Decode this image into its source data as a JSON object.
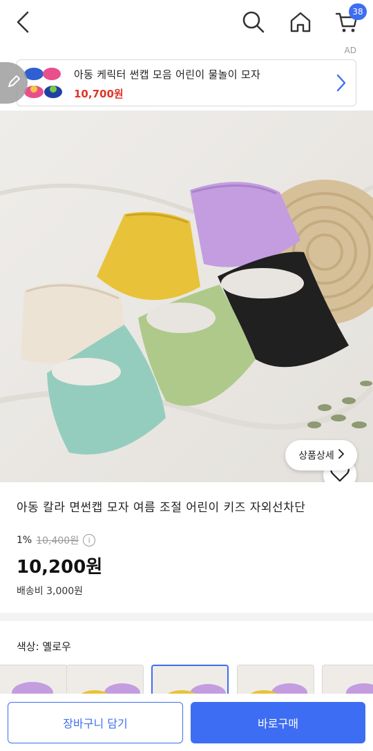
{
  "header": {
    "cart_count": "38",
    "icons": [
      "back-icon",
      "search-icon",
      "home-icon",
      "cart-icon"
    ]
  },
  "ad": {
    "label": "AD",
    "title": "아동 케릭터 썬캡 모음 어린이 물놀이 모자",
    "price": "10,700원"
  },
  "product": {
    "title": "아동 칼라 면썬캡 모자 여름 조절 어린이 키즈 자외선차단",
    "discount_rate": "1%",
    "original_price": "10,400원",
    "sale_price": "10,200원",
    "shipping": "배송비 3,000원",
    "detail_button": "상품상세"
  },
  "option": {
    "label": "색상: 옐로우"
  },
  "actions": {
    "cart_button": "장바구니 담기",
    "buy_button": "바로구매"
  },
  "colors": {
    "accent": "#3d6df2",
    "ad_price": "#e0352a"
  }
}
